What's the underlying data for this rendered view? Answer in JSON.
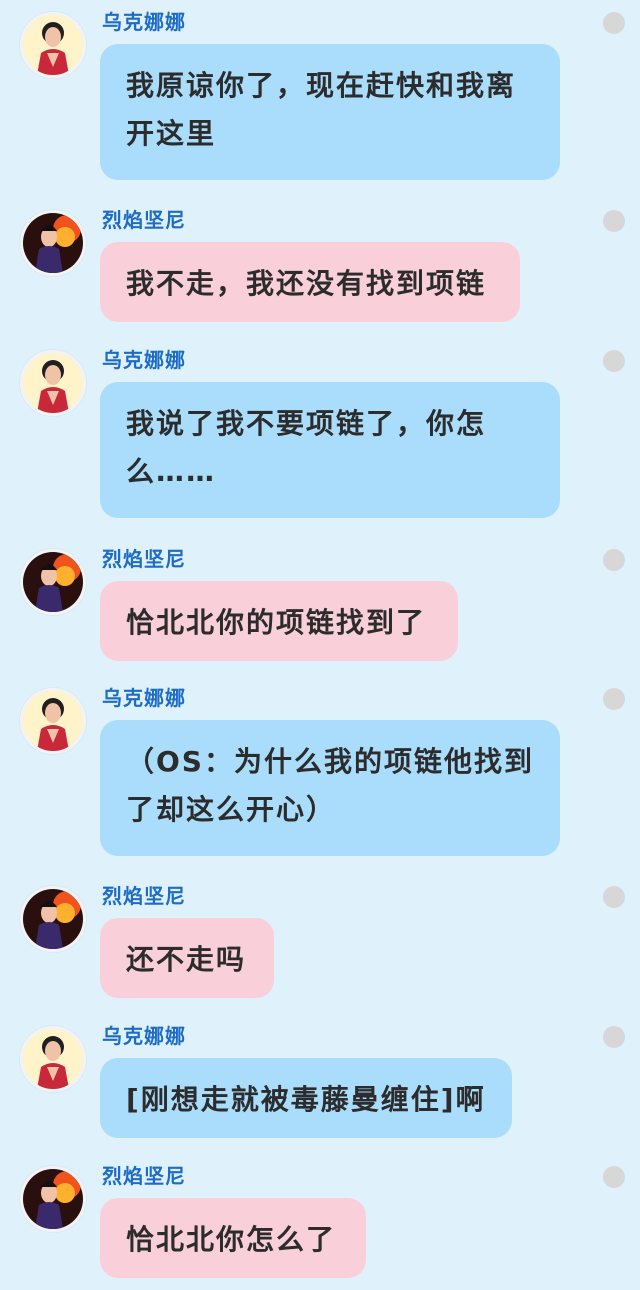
{
  "colors": {
    "background": "#dff1fb",
    "bubble_blue": "#a9ddfb",
    "bubble_pink": "#f9d0d9",
    "name_color": "#1d6cc6",
    "dot_color": "#d7d7d7"
  },
  "messages": [
    {
      "sender": "乌克娜娜",
      "text": "我原谅你了，现在赶快和我离开这里",
      "style": "blue",
      "avatar": "female-avatar-icon"
    },
    {
      "sender": "烈焰坚尼",
      "text": "我不走，我还没有找到项链",
      "style": "pink",
      "avatar": "male-avatar-icon"
    },
    {
      "sender": "乌克娜娜",
      "text": "我说了我不要项链了，你怎么……",
      "style": "blue",
      "avatar": "female-avatar-icon"
    },
    {
      "sender": "烈焰坚尼",
      "text": "恰北北你的项链找到了",
      "style": "pink",
      "avatar": "male-avatar-icon"
    },
    {
      "sender": "乌克娜娜",
      "text": "（OS：为什么我的项链他找到了却这么开心）",
      "style": "blue",
      "avatar": "female-avatar-icon"
    },
    {
      "sender": "烈焰坚尼",
      "text": "还不走吗",
      "style": "pink",
      "avatar": "male-avatar-icon"
    },
    {
      "sender": "乌克娜娜",
      "text": "[刚想走就被毒藤曼缠住]啊",
      "style": "blue",
      "avatar": "female-avatar-icon"
    },
    {
      "sender": "烈焰坚尼",
      "text": "恰北北你怎么了",
      "style": "pink",
      "avatar": "male-avatar-icon"
    }
  ]
}
